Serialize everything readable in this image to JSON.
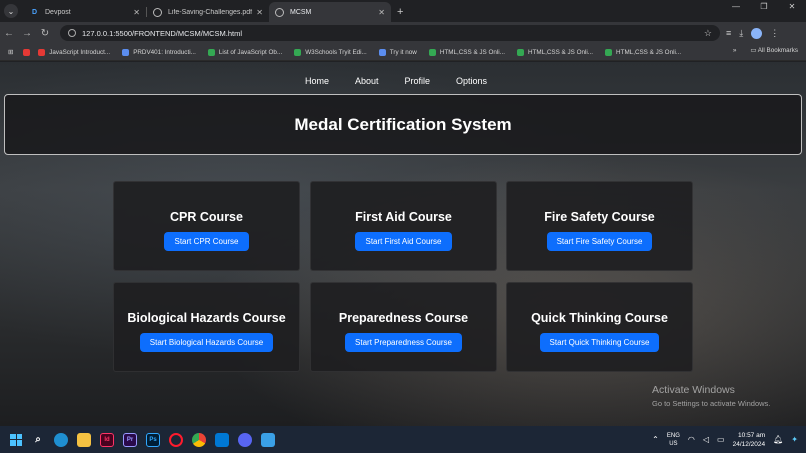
{
  "browser": {
    "tabs": [
      {
        "title": "Devpost",
        "icon": "devpost-icon"
      },
      {
        "title": "Life-Saving-Challenges.pdf",
        "icon": "globe-icon"
      },
      {
        "title": "MCSM",
        "icon": "globe-icon",
        "active": true
      }
    ],
    "url": "127.0.0.1:5500/FRONTEND/MCSM/MCSM.html",
    "bookmarks": [
      {
        "label": "JavaScript Introduct...",
        "color": "#e53935"
      },
      {
        "label": "PRDV401: Introducti...",
        "color": "#5b8def"
      },
      {
        "label": "List of JavaScript Ob...",
        "color": "#34a853"
      },
      {
        "label": "W3Schools Tryit Edi...",
        "color": "#34a853"
      },
      {
        "label": "Try it now",
        "color": "#5b8def"
      },
      {
        "label": "HTML,CSS & JS Onli...",
        "color": "#34a853"
      },
      {
        "label": "HTML,CSS & JS Onli...",
        "color": "#34a853"
      },
      {
        "label": "HTML,CSS & JS Onli...",
        "color": "#34a853"
      }
    ],
    "all_bookmarks": "All Bookmarks"
  },
  "page": {
    "nav": [
      "Home",
      "About",
      "Profile",
      "Options"
    ],
    "title": "Medal Certification System",
    "courses": [
      {
        "name": "CPR Course",
        "button": "Start CPR Course"
      },
      {
        "name": "First Aid Course",
        "button": "Start First Aid Course"
      },
      {
        "name": "Fire Safety Course",
        "button": "Start Fire Safety Course"
      },
      {
        "name": "Biological Hazards Course",
        "button": "Start Biological Hazards Course"
      },
      {
        "name": "Preparedness Course",
        "button": "Start Preparedness Course"
      },
      {
        "name": "Quick Thinking Course",
        "button": "Start Quick Thinking Course"
      }
    ],
    "button_color": "#0d6efd"
  },
  "watermark": {
    "line1": "Activate Windows",
    "line2": "Go to Settings to activate Windows."
  },
  "taskbar": {
    "lang": "ENG",
    "region": "US",
    "time": "10:57 am",
    "date": "24/12/2024"
  }
}
